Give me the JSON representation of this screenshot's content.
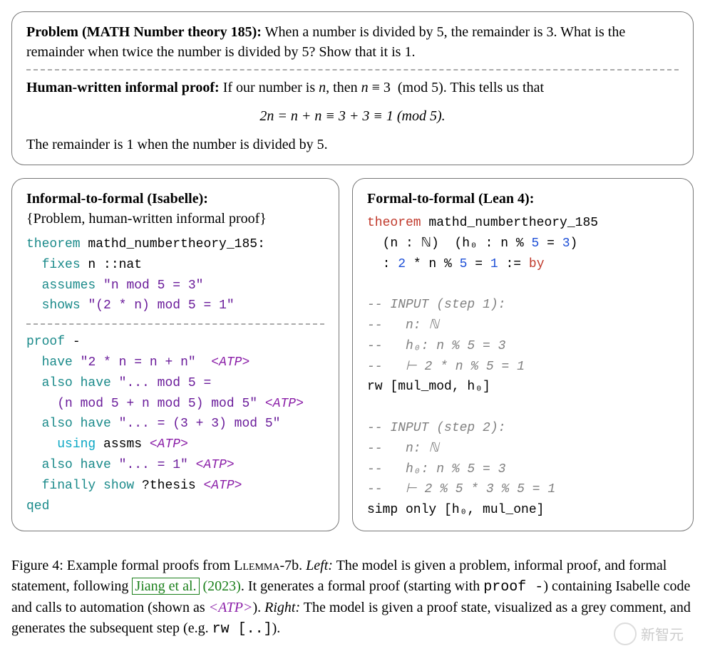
{
  "problem": {
    "prefix": "Problem (MATH Number theory 185):",
    "body": " When a number is divided by 5, the remainder is 3. What is the remainder when twice the number is divided by 5? Show that it is 1."
  },
  "informal": {
    "prefix": "Human-written informal proof:",
    "sent1": " If our number is n, then n ≡ 3  (mod 5). This tells us that",
    "equation": "2n = n + n ≡ 3 + 3 ≡ 1   (mod 5).",
    "sent2": "The remainder is 1 when the number is divided by 5."
  },
  "isabelle": {
    "title": "Informal-to-formal (Isabelle):",
    "subtitle": "{Problem, human-written informal proof}",
    "code_top": [
      {
        "indent": 0,
        "tokens": [
          {
            "t": "theorem",
            "c": "k-teal"
          },
          {
            "t": " mathd_numbertheory_185:",
            "c": "k-black"
          }
        ]
      },
      {
        "indent": 1,
        "tokens": [
          {
            "t": "fixes",
            "c": "k-teal"
          },
          {
            "t": " n ::nat",
            "c": "k-black"
          }
        ]
      },
      {
        "indent": 1,
        "tokens": [
          {
            "t": "assumes",
            "c": "k-teal"
          },
          {
            "t": " ",
            "c": "k-black"
          },
          {
            "t": "\"n mod 5 = 3\"",
            "c": "k-str"
          }
        ]
      },
      {
        "indent": 1,
        "tokens": [
          {
            "t": "shows",
            "c": "k-teal"
          },
          {
            "t": " ",
            "c": "k-black"
          },
          {
            "t": "\"(2 * n) mod 5 = 1\"",
            "c": "k-str"
          }
        ]
      }
    ],
    "code_bot": [
      {
        "indent": 0,
        "tokens": [
          {
            "t": "proof",
            "c": "k-teal"
          },
          {
            "t": " -",
            "c": "k-black"
          }
        ]
      },
      {
        "indent": 1,
        "tokens": [
          {
            "t": "have",
            "c": "k-teal"
          },
          {
            "t": " ",
            "c": "k-black"
          },
          {
            "t": "\"2 * n = n + n\"",
            "c": "k-str"
          },
          {
            "t": "  ",
            "c": "k-black"
          },
          {
            "t": "<ATP>",
            "c": "k-atp"
          }
        ]
      },
      {
        "indent": 1,
        "tokens": [
          {
            "t": "also have",
            "c": "k-teal"
          },
          {
            "t": " ",
            "c": "k-black"
          },
          {
            "t": "\"... mod 5 =",
            "c": "k-str"
          }
        ]
      },
      {
        "indent": 2,
        "tokens": [
          {
            "t": "(n mod 5 + n mod 5) mod 5\"",
            "c": "k-str"
          },
          {
            "t": " ",
            "c": "k-black"
          },
          {
            "t": "<ATP>",
            "c": "k-atp"
          }
        ]
      },
      {
        "indent": 1,
        "tokens": [
          {
            "t": "also have",
            "c": "k-teal"
          },
          {
            "t": " ",
            "c": "k-black"
          },
          {
            "t": "\"... = (3 + 3) mod 5\"",
            "c": "k-str"
          }
        ]
      },
      {
        "indent": 2,
        "tokens": [
          {
            "t": "using",
            "c": "k-cyan"
          },
          {
            "t": " assms ",
            "c": "k-black"
          },
          {
            "t": "<ATP>",
            "c": "k-atp"
          }
        ]
      },
      {
        "indent": 1,
        "tokens": [
          {
            "t": "also have",
            "c": "k-teal"
          },
          {
            "t": " ",
            "c": "k-black"
          },
          {
            "t": "\"... = 1\"",
            "c": "k-str"
          },
          {
            "t": " ",
            "c": "k-black"
          },
          {
            "t": "<ATP>",
            "c": "k-atp"
          }
        ]
      },
      {
        "indent": 1,
        "tokens": [
          {
            "t": "finally show",
            "c": "k-teal"
          },
          {
            "t": " ?thesis ",
            "c": "k-black"
          },
          {
            "t": "<ATP>",
            "c": "k-atp"
          }
        ]
      },
      {
        "indent": 0,
        "tokens": [
          {
            "t": "qed",
            "c": "k-teal"
          }
        ]
      }
    ]
  },
  "lean": {
    "title": "Formal-to-formal (Lean 4):",
    "code": [
      {
        "indent": 0,
        "tokens": [
          {
            "t": "theorem",
            "c": "k-red"
          },
          {
            "t": " mathd_numbertheory_185",
            "c": "k-black"
          }
        ]
      },
      {
        "indent": 1,
        "tokens": [
          {
            "t": "(n : ",
            "c": "k-black"
          },
          {
            "t": "ℕ",
            "c": "k-black"
          },
          {
            "t": ")  (h₀ : n % ",
            "c": "k-black"
          },
          {
            "t": "5",
            "c": "k-blue"
          },
          {
            "t": " = ",
            "c": "k-black"
          },
          {
            "t": "3",
            "c": "k-blue"
          },
          {
            "t": ")",
            "c": "k-black"
          }
        ]
      },
      {
        "indent": 1,
        "tokens": [
          {
            "t": ": ",
            "c": "k-black"
          },
          {
            "t": "2",
            "c": "k-blue"
          },
          {
            "t": " * n % ",
            "c": "k-black"
          },
          {
            "t": "5",
            "c": "k-blue"
          },
          {
            "t": " = ",
            "c": "k-black"
          },
          {
            "t": "1",
            "c": "k-blue"
          },
          {
            "t": " := ",
            "c": "k-black"
          },
          {
            "t": "by",
            "c": "k-red"
          }
        ]
      },
      {
        "indent": 0,
        "tokens": [
          {
            "t": " ",
            "c": "k-black"
          }
        ]
      },
      {
        "indent": 0,
        "tokens": [
          {
            "t": "-- INPUT (step 1):",
            "c": "k-comm"
          }
        ]
      },
      {
        "indent": 0,
        "tokens": [
          {
            "t": "--   n: ℕ",
            "c": "k-comm"
          }
        ]
      },
      {
        "indent": 0,
        "tokens": [
          {
            "t": "--   h₀: n % 5 = 3",
            "c": "k-comm"
          }
        ]
      },
      {
        "indent": 0,
        "tokens": [
          {
            "t": "--   ⊢ 2 * n % 5 = 1",
            "c": "k-comm"
          }
        ]
      },
      {
        "indent": 0,
        "tokens": [
          {
            "t": "rw [mul_mod, h₀]",
            "c": "k-black"
          }
        ]
      },
      {
        "indent": 0,
        "tokens": [
          {
            "t": " ",
            "c": "k-black"
          }
        ]
      },
      {
        "indent": 0,
        "tokens": [
          {
            "t": "-- INPUT (step 2):",
            "c": "k-comm"
          }
        ]
      },
      {
        "indent": 0,
        "tokens": [
          {
            "t": "--   n: ℕ",
            "c": "k-comm"
          }
        ]
      },
      {
        "indent": 0,
        "tokens": [
          {
            "t": "--   h₀: n % 5 = 3",
            "c": "k-comm"
          }
        ]
      },
      {
        "indent": 0,
        "tokens": [
          {
            "t": "--   ⊢ 2 % 5 * 3 % 5 = 1",
            "c": "k-comm"
          }
        ]
      },
      {
        "indent": 0,
        "tokens": [
          {
            "t": "simp only [h₀, mul_one]",
            "c": "k-black"
          }
        ]
      }
    ]
  },
  "caption": {
    "label": "Figure 4:",
    "model": "Llemma",
    "modelsuf": "-7b.",
    "lead": " Example formal proofs from ",
    "left_label": "Left:",
    "left_body": " The model is given a problem, informal proof, and formal statement, following ",
    "cite_text": "Jiang et al.",
    "cite_year": "(2023)",
    "left_cont": ". It generates a formal proof (starting with ",
    "proof_dash": "proof -",
    "left_cont2": ") containing Isabelle code and calls to automation (shown as ",
    "atp": "<ATP>",
    "left_cont3": "). ",
    "right_label": "Right:",
    "right_body": " The model is given a proof state, visualized as a grey comment, and generates the subsequent step (e.g. ",
    "rw": "rw [..]",
    "right_body2": ")."
  },
  "watermark": "新智元"
}
